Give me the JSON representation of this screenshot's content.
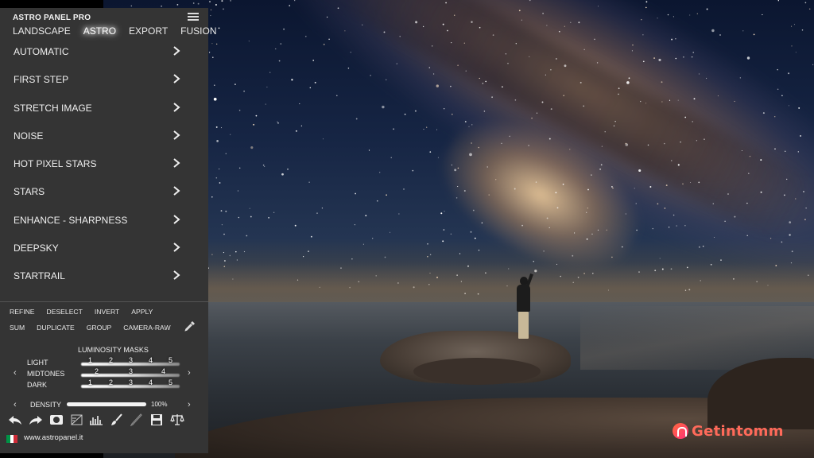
{
  "app": {
    "title": "ASTRO PANEL PRO"
  },
  "tabs": [
    {
      "label": "LANDSCAPE",
      "active": false
    },
    {
      "label": "ASTRO",
      "active": true
    },
    {
      "label": "EXPORT",
      "active": false
    },
    {
      "label": "FUSION",
      "active": false
    }
  ],
  "menu": [
    "AUTOMATIC",
    "FIRST STEP",
    "STRETCH IMAGE",
    "NOISE",
    "HOT PIXEL STARS",
    "STARS",
    "ENHANCE - SHARPNESS",
    "DEEPSKY",
    "STARTRAIL"
  ],
  "actions_row1": [
    "REFINE",
    "DESELECT",
    "INVERT",
    "APPLY"
  ],
  "actions_row2": [
    "SUM",
    "DUPLICATE",
    "GROUP",
    "CAMERA-RAW"
  ],
  "luminosity": {
    "title": "LUMINOSITY MASKS",
    "light": {
      "label": "LIGHT",
      "levels": [
        "1",
        "2",
        "3",
        "4",
        "5"
      ]
    },
    "midtones": {
      "label": "MIDTONES",
      "levels": [
        "2",
        "3",
        "4"
      ]
    },
    "dark": {
      "label": "DARK",
      "levels": [
        "1",
        "2",
        "3",
        "4",
        "5"
      ]
    }
  },
  "density": {
    "label": "DENSITY",
    "value_text": "100%",
    "value": 100
  },
  "tools": [
    "undo-icon",
    "redo-icon",
    "mask-icon",
    "levels-icon",
    "histogram-icon",
    "brush-icon",
    "pen-icon",
    "save-icon",
    "balance-icon"
  ],
  "footer": {
    "site": "www.astropanel.it",
    "flag_colors": [
      "#009246",
      "#ffffff",
      "#ce2b37"
    ]
  },
  "watermark": {
    "text": "Getintomm"
  }
}
